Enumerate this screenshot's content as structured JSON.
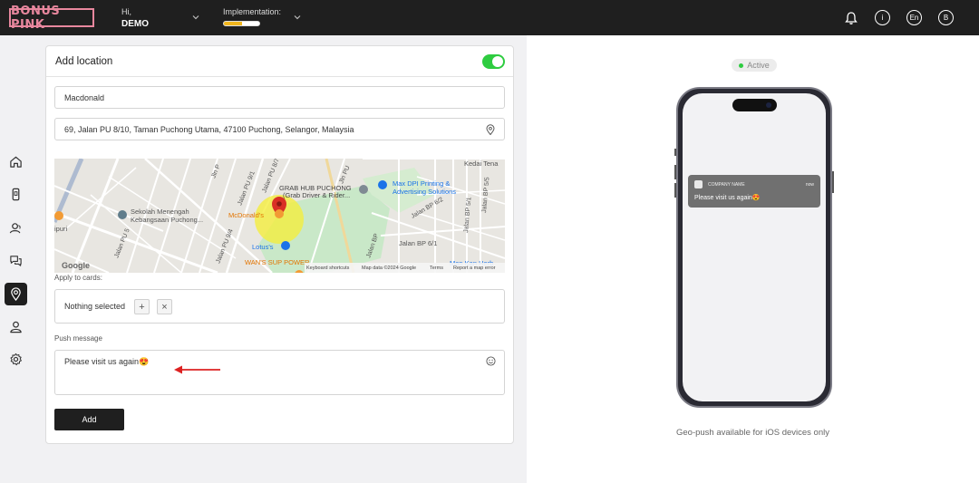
{
  "header": {
    "logo_text": "BONUS PINK",
    "greeting": "Hi,",
    "user_name": "DEMO",
    "implementation_label": "Implementation:",
    "implementation_progress": 0.5,
    "language": "En",
    "avatar_initial": "B",
    "info_glyph": "i"
  },
  "sidebar": {
    "items": [
      {
        "name": "home-icon"
      },
      {
        "name": "mobile-card-icon"
      },
      {
        "name": "customers-icon"
      },
      {
        "name": "messages-icon"
      },
      {
        "name": "location-icon",
        "active": true
      },
      {
        "name": "user-icon"
      },
      {
        "name": "settings-icon"
      }
    ]
  },
  "form": {
    "title": "Add location",
    "enabled": true,
    "location_name": "Macdonald",
    "address": "69, Jalan PU 8/10, Taman Puchong Utama, 47100 Puchong, Selangor, Malaysia",
    "map": {
      "labels": {
        "grab_1": "GRAB HUB PUCHONG",
        "grab_2": "(Grab Driver & Rider...",
        "maxdpi_1": "Max DPI Printing &",
        "maxdpi_2": "Advertising Solutions",
        "school_1": "Sekolah Menengah",
        "school_2": "Kebangsaan Puchong...",
        "mcd": "McDonald's",
        "lotus": "Lotus's",
        "wans": "WAN'S SUP POWER",
        "kedai": "Kedai Tena",
        "ipuri": "ipuri",
        "road_pu5": "Jalan PU 5",
        "road_pu94": "Jalan PU 9/4",
        "road_pu91": "Jalan PU 9/1",
        "road_pu87": "Jalan PU 8/7",
        "road_bp61": "Jalan BP 6/1",
        "road_bp62": "Jalan BP 6/2",
        "road_bp5a": "Jalan BP 5/1",
        "road_bp5b": "Jalan BP 5/5",
        "road_bp": "Jalan BP",
        "road_jln": "Jln P",
        "road_jlnpu": "Jln PU",
        "man_kan": "Man Kan Herb",
        "google": "Google",
        "shortcuts": "Keyboard shortcuts",
        "mapdata": "Map data ©2024 Google",
        "terms": "Terms",
        "report": "Report a map error"
      }
    },
    "apply_label": "Apply to cards:",
    "cards_value": "Nothing selected",
    "add_card_symbol": "+",
    "clear_card_symbol": "×",
    "push_label": "Push message",
    "push_message": "Please visit us again😍",
    "submit_label": "Add"
  },
  "preview": {
    "status": "Active",
    "notification": {
      "company": "COMPANY NAME",
      "time": "now",
      "message": "Please visit us again😍"
    },
    "caption": "Geo-push available for iOS devices only"
  },
  "colors": {
    "topbar": "#1f1f1f",
    "brand_pink": "#e8879e",
    "toggle_on": "#2ecc40",
    "progress": "#f1b61d",
    "arrow": "#d22"
  }
}
